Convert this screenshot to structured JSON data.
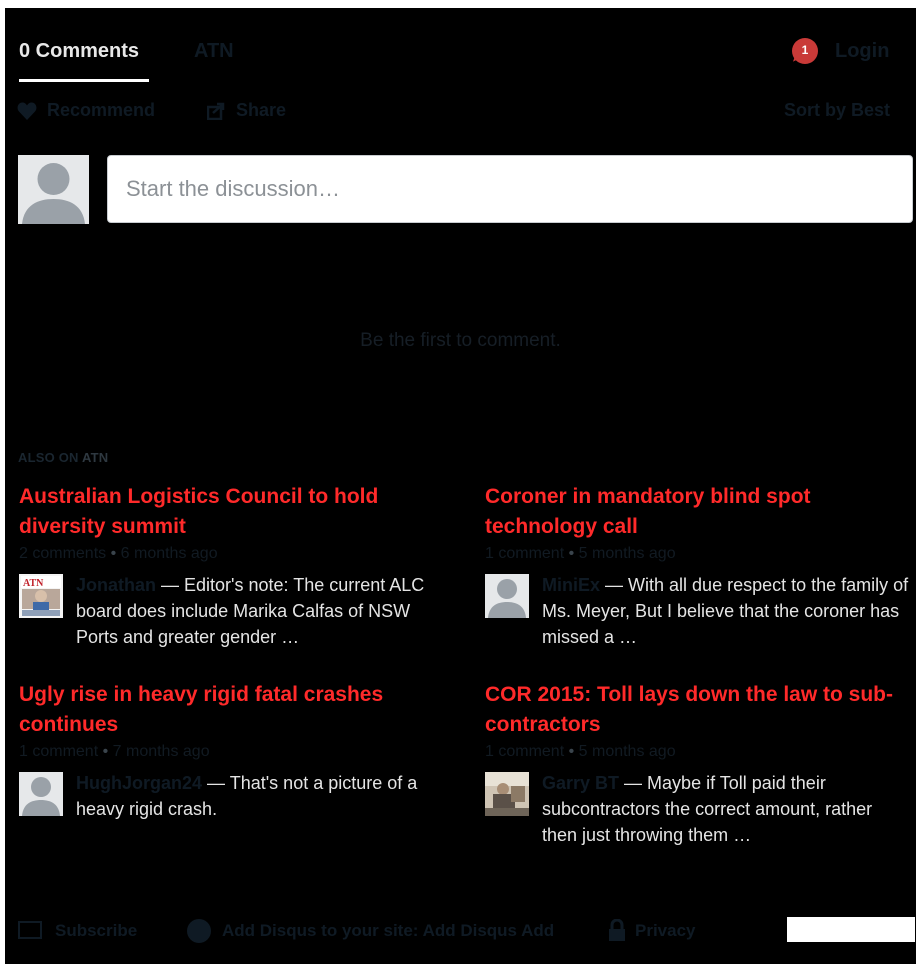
{
  "tabs": {
    "comments_label": "0 Comments",
    "site_label": "ATN",
    "notification_count": "1",
    "login_label": "Login"
  },
  "actions": {
    "recommend_label": "Recommend",
    "share_label": "Share",
    "sort_label": "Sort by Best"
  },
  "composer": {
    "placeholder": "Start the discussion…"
  },
  "empty_state": "Be the first to comment.",
  "also_on": {
    "prefix": "ALSO ON",
    "site": "ATN"
  },
  "cards": [
    {
      "title": "Australian Logistics Council to hold diversity summit",
      "comments": "2 comments",
      "age": "6 months ago",
      "user": "Jonathan",
      "snippet": "— Editor's note: The current ALC board does include Marika Calfas of NSW Ports and greater gender …"
    },
    {
      "title": "Coroner in mandatory blind spot technology call",
      "comments": "1 comment",
      "age": "5 months ago",
      "user": "MiniEx",
      "snippet": "— With all due respect to the family of Ms. Meyer, But I believe that the coroner has missed a …"
    },
    {
      "title": "Ugly rise in heavy rigid fatal crashes continues",
      "comments": "1 comment",
      "age": "7 months ago",
      "user": "HughJorgan24",
      "snippet": "— That's not a picture of a heavy rigid crash."
    },
    {
      "title": "COR 2015: Toll lays down the law to sub-contractors",
      "comments": "1 comment",
      "age": "5 months ago",
      "user": "Garry BT",
      "snippet": "— Maybe if Toll paid their subcontractors the correct amount, rather then just throwing them …"
    }
  ],
  "footer": {
    "subscribe_label": "Subscribe",
    "add_disqus_label": "Add Disqus to your site",
    "add_disqus_short": "Add Disqus Add",
    "privacy_label": "Privacy"
  },
  "colors": {
    "accent_red": "#ff2a2a",
    "badge_red": "#c93a38",
    "background": "#000000"
  }
}
